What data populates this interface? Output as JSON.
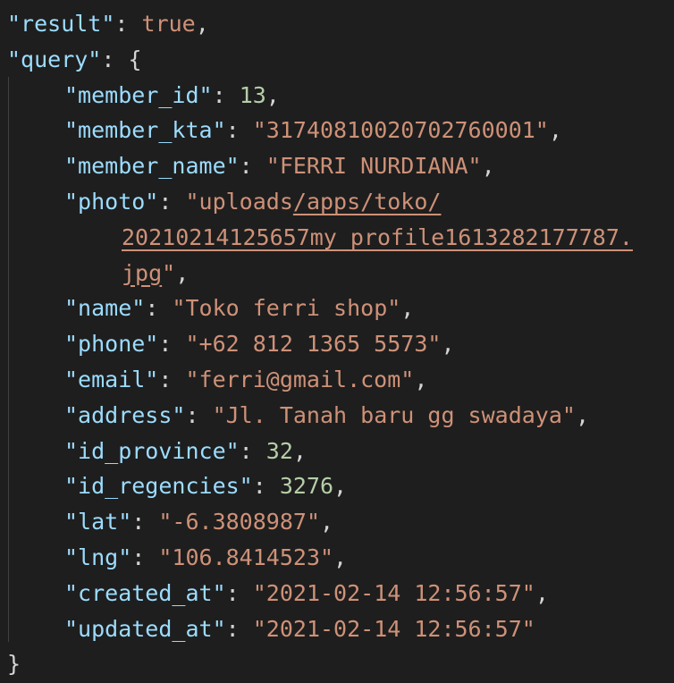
{
  "editor": {
    "lines": [
      {
        "key": "\"result\"",
        "sep": ": ",
        "value": "true",
        "type": "kw",
        "end": ","
      },
      {
        "key": "\"query\"",
        "sep": ": ",
        "value": "{",
        "type": "punc",
        "end": ""
      },
      {
        "key": "\"member_id\"",
        "sep": ": ",
        "value": "13",
        "type": "num",
        "end": ","
      },
      {
        "key": "\"member_kta\"",
        "sep": ": ",
        "value": "\"31740810020702760001\"",
        "type": "str",
        "end": ","
      },
      {
        "key": "\"member_name\"",
        "sep": ": ",
        "value": "\"FERRI NURDIANA\"",
        "type": "str",
        "end": ","
      },
      {
        "key": "\"photo\"",
        "sep": ": ",
        "value_part1": "\"uploads",
        "value_link1": "/apps/toko/",
        "value_link2": "20210214125657my_profile1613282177787.",
        "value_link3": "jpg",
        "value_part2": "\"",
        "end": ","
      },
      {
        "key": "\"name\"",
        "sep": ": ",
        "value": "\"Toko ferri shop\"",
        "type": "str",
        "end": ","
      },
      {
        "key": "\"phone\"",
        "sep": ": ",
        "value": "\"+62 812 1365 5573\"",
        "type": "str",
        "end": ","
      },
      {
        "key": "\"email\"",
        "sep": ": ",
        "value": "\"ferri@gmail.com\"",
        "type": "str",
        "end": ","
      },
      {
        "key": "\"address\"",
        "sep": ": ",
        "value": "\"Jl. Tanah baru gg swadaya\"",
        "type": "str",
        "end": ","
      },
      {
        "key": "\"id_province\"",
        "sep": ": ",
        "value": "32",
        "type": "num",
        "end": ","
      },
      {
        "key": "\"id_regencies\"",
        "sep": ": ",
        "value": "3276",
        "type": "num",
        "end": ","
      },
      {
        "key": "\"lat\"",
        "sep": ": ",
        "value": "\"-6.3808987\"",
        "type": "str",
        "end": ","
      },
      {
        "key": "\"lng\"",
        "sep": ": ",
        "value": "\"106.8414523\"",
        "type": "str",
        "end": ","
      },
      {
        "key": "\"created_at\"",
        "sep": ": ",
        "value": "\"2021-02-14 12:56:57\"",
        "type": "str",
        "end": ","
      },
      {
        "key": "\"updated_at\"",
        "sep": ": ",
        "value": "\"2021-02-14 12:56:57\"",
        "type": "str",
        "end": ""
      }
    ],
    "closing_brace": "}"
  },
  "colors": {
    "background": "#1e1e1e",
    "key": "#9cdcfe",
    "string": "#ce9178",
    "number": "#b5cea8",
    "punctuation": "#d4d4d4"
  }
}
